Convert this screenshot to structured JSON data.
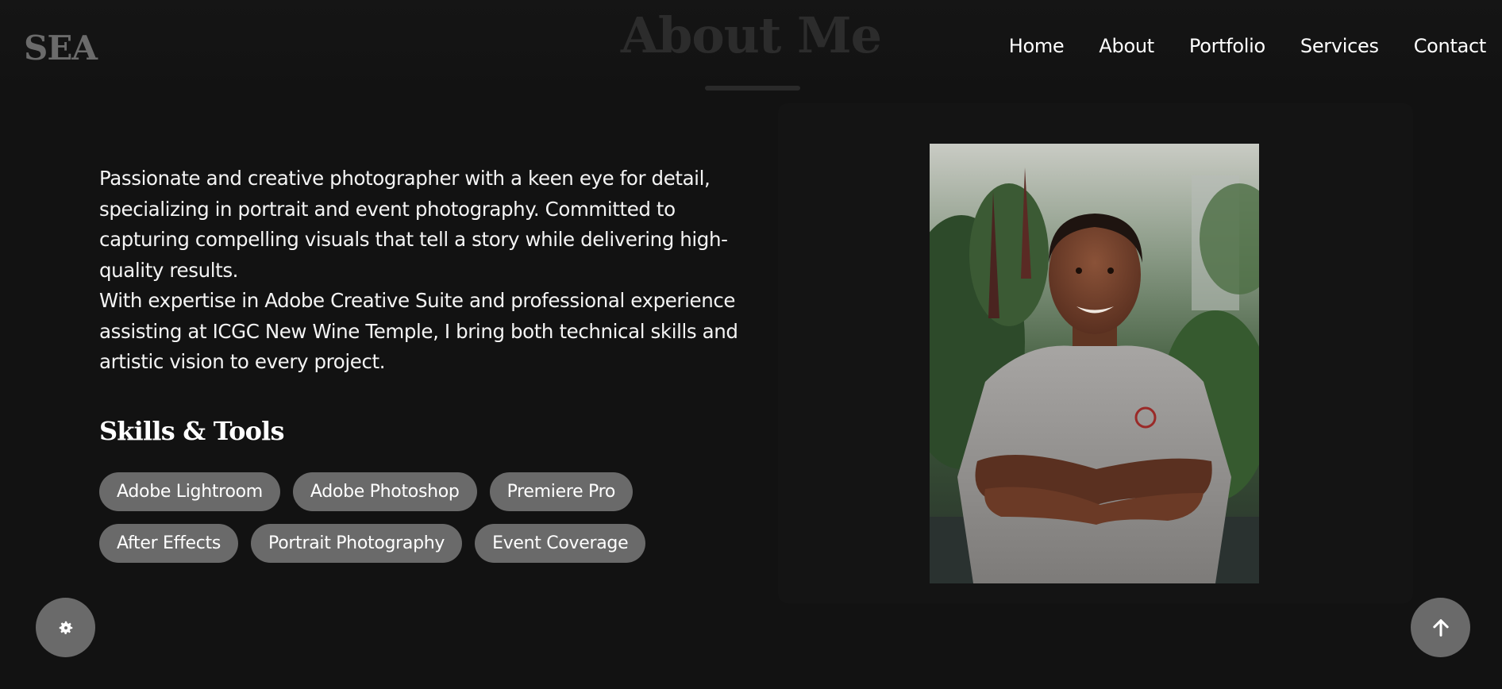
{
  "header": {
    "logo": "SEA",
    "section_title": "About Me",
    "nav": [
      "Home",
      "About",
      "Portfolio",
      "Services",
      "Contact"
    ]
  },
  "about": {
    "paragraphs": [
      "Passionate and creative photographer with a keen eye for detail, specializing in portrait and event photography. Committed to capturing compelling visuals that tell a story while delivering high-quality results.",
      "With expertise in Adobe Creative Suite and professional experience assisting at ICGC New Wine Temple, I bring both technical skills and artistic vision to every project."
    ],
    "skills_heading": "Skills & Tools",
    "skills": [
      "Adobe Lightroom",
      "Adobe Photoshop",
      "Premiere Pro",
      "After Effects",
      "Portrait Photography",
      "Event Coverage"
    ]
  },
  "icons": {
    "theme_toggle": "gear-icon",
    "back_to_top": "arrow-up-icon"
  },
  "colors": {
    "background": "#121212",
    "chip": "#6a6a6a",
    "text": "#f4f4f4"
  }
}
